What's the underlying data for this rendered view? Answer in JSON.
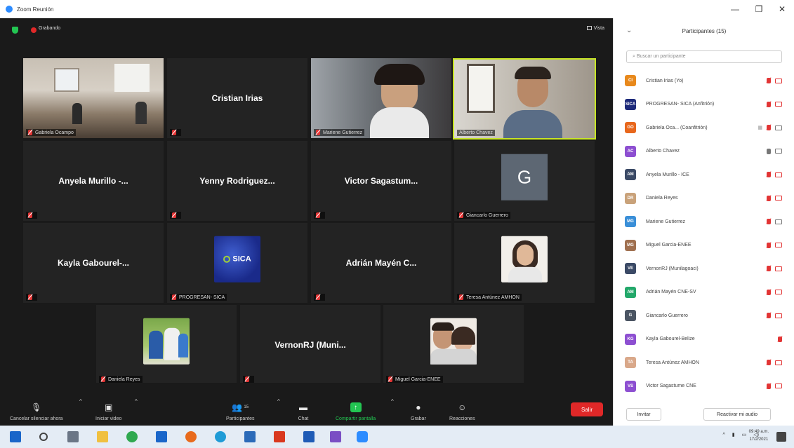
{
  "window": {
    "title": "Zoom Reunión",
    "minimize": "—",
    "restore": "❐",
    "close": "✕"
  },
  "meeting": {
    "recording_label": "Grabando",
    "view_label": "Vista"
  },
  "tiles": [
    {
      "kind": "video",
      "label": "Gabriela Ocampo",
      "photo": "office-room"
    },
    {
      "kind": "name",
      "name": "Cristian Irias"
    },
    {
      "kind": "video",
      "label": "Mariene Gutierrez",
      "photo": "woman-glasses"
    },
    {
      "kind": "video",
      "label": "Alberto Chavez",
      "photo": "man-window",
      "active": true
    },
    {
      "kind": "name",
      "name": "Anyela Murillo -..."
    },
    {
      "kind": "name",
      "name": "Yenny Rodriguez..."
    },
    {
      "kind": "name",
      "name": "Victor Sagastum..."
    },
    {
      "kind": "letter",
      "letter": "G",
      "label": "Giancarlo Guerrero"
    },
    {
      "kind": "name",
      "name": "Kayla Gabourel-..."
    },
    {
      "kind": "logo",
      "logo_text": "SICA",
      "label": "PROGRESAN- SICA"
    },
    {
      "kind": "name",
      "name": "Adrián Mayén C..."
    },
    {
      "kind": "pic",
      "label": "Teresa Antúnez AMHON",
      "photo": "woman-portrait"
    },
    {
      "kind": "pic",
      "label": "Daniela Reyes",
      "photo": "people-outdoor"
    },
    {
      "kind": "name",
      "name": "VernonRJ (Muni..."
    },
    {
      "kind": "pic",
      "label": "Miguel Garcia-ENEE",
      "photo": "couple"
    }
  ],
  "toolbar": {
    "unmute": "Cancelar silenciar ahora",
    "start_video": "Iniciar video",
    "participants": "Participantes",
    "participants_count": "15",
    "chat": "Chat",
    "share": "Compartir pantalla",
    "record": "Grabar",
    "reactions": "Reacciones",
    "end": "Salir"
  },
  "panel": {
    "title": "Participantes (15)",
    "search_placeholder": "Buscar un participante",
    "invite": "Invitar",
    "reactivate_audio": "Reactivar mi audio",
    "participants": [
      {
        "initials": "CI",
        "color": "#e8891c",
        "name": "Cristian Irias (Yo)",
        "mic": "muted",
        "cam": "off"
      },
      {
        "initials": "SICA",
        "color": "#1d2a7a",
        "name": "PROGRESAN- SICA (Anfitrión)",
        "mic": "muted",
        "cam": "off"
      },
      {
        "initials": "GO",
        "color": "#e8671c",
        "name": "Gabriela Oca... (Coanfitrión)",
        "mic": "muted",
        "cam": "on",
        "extra": "▦"
      },
      {
        "initials": "AC",
        "color": "#8d4fd1",
        "name": "Alberto Chavez",
        "mic": "on",
        "cam": "on"
      },
      {
        "initials": "AM",
        "color": "#3b4a66",
        "name": "Anyela Murillo - ICE",
        "mic": "muted",
        "cam": "off"
      },
      {
        "initials": "DR",
        "color": "#c9a27a",
        "name": "Daniela Reyes",
        "mic": "muted",
        "cam": "off"
      },
      {
        "initials": "MG",
        "color": "#3a8fd8",
        "name": "Mariene Gutierrez",
        "mic": "muted",
        "cam": "on"
      },
      {
        "initials": "MG",
        "color": "#a07050",
        "name": "Miguel Garcia-ENEE",
        "mic": "muted",
        "cam": "off"
      },
      {
        "initials": "VE",
        "color": "#3b4a66",
        "name": "VernonRJ (Munilagoaci)",
        "mic": "muted",
        "cam": "off"
      },
      {
        "initials": "AM",
        "color": "#23a86a",
        "name": "Adrián Mayén CNE-SV",
        "mic": "muted",
        "cam": "off"
      },
      {
        "initials": "G",
        "color": "#4b5563",
        "name": "Giancarlo Guerrero",
        "mic": "muted",
        "cam": "off"
      },
      {
        "initials": "KG",
        "color": "#8d4fd1",
        "name": "Kayla Gabourel-Belize",
        "mic": "muted",
        "cam": "none"
      },
      {
        "initials": "TA",
        "color": "#d9a88a",
        "name": "Teresa Antúnez AMHON",
        "mic": "muted",
        "cam": "off"
      },
      {
        "initials": "VS",
        "color": "#8d4fd1",
        "name": "Victor Sagastume CNE",
        "mic": "muted",
        "cam": "off"
      }
    ]
  },
  "taskbar": {
    "time": "09:49 a.m.",
    "date": "17/2/2021"
  }
}
